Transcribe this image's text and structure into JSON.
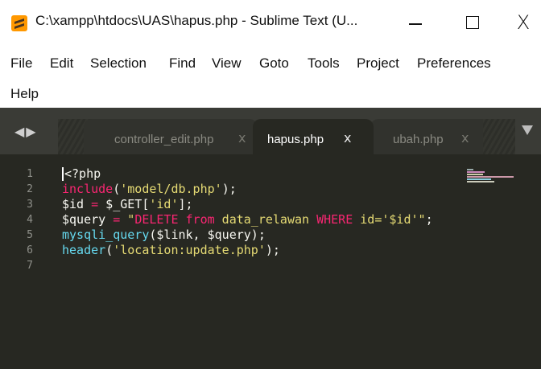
{
  "window": {
    "title": "C:\\xampp\\htdocs\\UAS\\hapus.php - Sublime Text (U...",
    "minimize_label": "",
    "close_glyph": "X"
  },
  "menu": {
    "items": [
      "File",
      "Edit",
      "Selection",
      "Find",
      "View",
      "Goto",
      "Tools",
      "Project",
      "Preferences",
      "Help"
    ]
  },
  "tabs": [
    {
      "label": "controller_edit.php",
      "close": "x",
      "active": false
    },
    {
      "label": "hapus.php",
      "close": "x",
      "active": true
    },
    {
      "label": "ubah.php",
      "close": "x",
      "active": false
    }
  ],
  "nav_arrows": "◀▶",
  "editor": {
    "line_numbers": [
      "1",
      "2",
      "3",
      "4",
      "5",
      "6",
      "7"
    ],
    "lines": [
      [
        {
          "t": "<?php",
          "c": "p"
        }
      ],
      [
        {
          "t": "include",
          "c": "k"
        },
        {
          "t": "(",
          "c": "p"
        },
        {
          "t": "'model/db.php'",
          "c": "s"
        },
        {
          "t": ");",
          "c": "p"
        }
      ],
      [
        {
          "t": "$id ",
          "c": "p"
        },
        {
          "t": "=",
          "c": "k"
        },
        {
          "t": " $_GET[",
          "c": "p"
        },
        {
          "t": "'id'",
          "c": "s"
        },
        {
          "t": "];",
          "c": "p"
        }
      ],
      [
        {
          "t": "$query ",
          "c": "p"
        },
        {
          "t": "=",
          "c": "k"
        },
        {
          "t": " ",
          "c": "p"
        },
        {
          "t": "\"",
          "c": "s"
        },
        {
          "t": "DELETE",
          "c": "k"
        },
        {
          "t": " ",
          "c": "s"
        },
        {
          "t": "from",
          "c": "k"
        },
        {
          "t": " data_relawan ",
          "c": "s"
        },
        {
          "t": "WHERE",
          "c": "k"
        },
        {
          "t": " id='$id'\"",
          "c": "s"
        },
        {
          "t": ";",
          "c": "p"
        }
      ],
      [
        {
          "t": "mysqli_query",
          "c": "f"
        },
        {
          "t": "($link, $query);",
          "c": "p"
        }
      ],
      [
        {
          "t": "header",
          "c": "f"
        },
        {
          "t": "(",
          "c": "p"
        },
        {
          "t": "'location:update.php'",
          "c": "s"
        },
        {
          "t": ");",
          "c": "p"
        }
      ],
      [
        {
          "t": "",
          "c": "p"
        }
      ]
    ]
  },
  "colors": {
    "background": "#272822",
    "keyword": "#f92672",
    "string": "#e6db74",
    "function": "#66d9ef",
    "text": "#f8f8f2",
    "gutter_text": "#8f908a",
    "app_icon": "#ff9800"
  }
}
